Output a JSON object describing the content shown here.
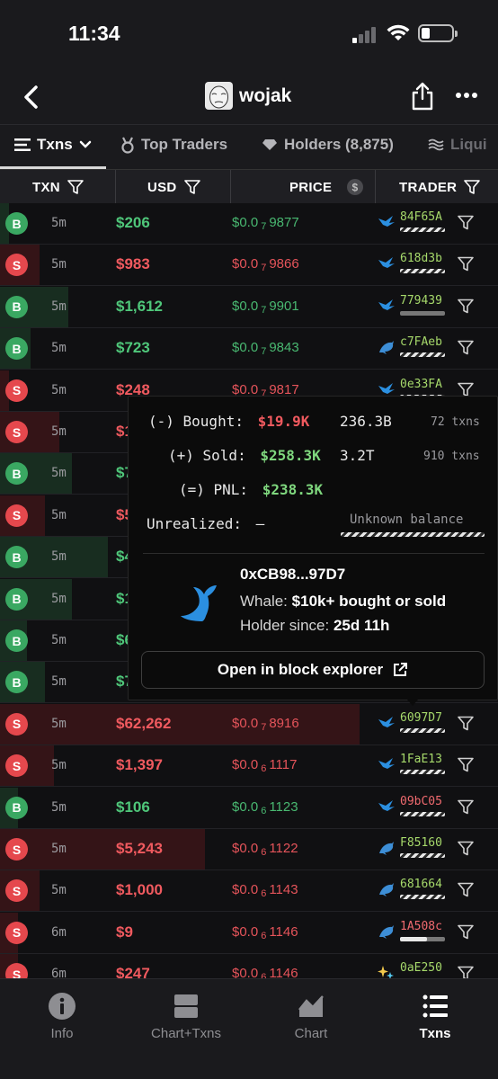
{
  "status": {
    "time": "11:34"
  },
  "header": {
    "token_name": "wojak"
  },
  "tabs": [
    {
      "label": "Txns",
      "active": true
    },
    {
      "label": "Top Traders"
    },
    {
      "label": "Holders (8,875)"
    },
    {
      "label": "Liqui"
    }
  ],
  "columns": {
    "txn": "TXN",
    "usd": "USD",
    "price": "PRICE",
    "trader": "TRADER"
  },
  "colors": {
    "buy": "#4fc77a",
    "sell": "#f05a5f",
    "bar": "#e8e8e8"
  },
  "rows": [
    {
      "type": "B",
      "age": "5m",
      "usd": "$206",
      "price_pre": "$0.0",
      "price_sub": "7",
      "price_post": "9877",
      "trader": "84F65A",
      "trader_icon": "bird-icon",
      "fill": 0.0,
      "hatched": true
    },
    {
      "type": "S",
      "age": "5m",
      "usd": "$983",
      "price_pre": "$0.0",
      "price_sub": "7",
      "price_post": "9866",
      "trader": "618d3b",
      "trader_icon": "bird-icon",
      "hatched": true
    },
    {
      "type": "B",
      "age": "5m",
      "usd": "$1,612",
      "price_pre": "$0.0",
      "price_sub": "7",
      "price_post": "9901",
      "trader": "779439",
      "trader_icon": "bird-icon",
      "hatched": false,
      "fill": 0.0
    },
    {
      "type": "B",
      "age": "5m",
      "usd": "$723",
      "price_pre": "$0.0",
      "price_sub": "7",
      "price_post": "9843",
      "trader": "c7FAeb",
      "trader_icon": "dolphin-icon",
      "hatched": true
    },
    {
      "type": "S",
      "age": "5m",
      "usd": "$248",
      "price_pre": "$0.0",
      "price_sub": "7",
      "price_post": "9817",
      "trader": "0e33FA",
      "trader_icon": "bird-icon",
      "hatched": true
    },
    {
      "type": "S",
      "age": "5m",
      "usd": "$1",
      "price_pre": "",
      "price_sub": "",
      "price_post": "",
      "trader": "",
      "trader_icon": ""
    },
    {
      "type": "B",
      "age": "5m",
      "usd": "$7",
      "price_pre": "",
      "price_sub": "",
      "price_post": "",
      "trader": "",
      "trader_icon": ""
    },
    {
      "type": "S",
      "age": "5m",
      "usd": "$5",
      "price_pre": "",
      "price_sub": "",
      "price_post": "",
      "trader": "",
      "trader_icon": ""
    },
    {
      "type": "B",
      "age": "5m",
      "usd": "$4",
      "price_pre": "",
      "price_sub": "",
      "price_post": "",
      "trader": "",
      "trader_icon": ""
    },
    {
      "type": "B",
      "age": "5m",
      "usd": "$1",
      "price_pre": "",
      "price_sub": "",
      "price_post": "",
      "trader": "",
      "trader_icon": ""
    },
    {
      "type": "B",
      "age": "5m",
      "usd": "$6",
      "price_pre": "",
      "price_sub": "",
      "price_post": "",
      "trader": "",
      "trader_icon": ""
    },
    {
      "type": "B",
      "age": "5m",
      "usd": "$7",
      "price_pre": "",
      "price_sub": "",
      "price_post": "",
      "trader": "",
      "trader_icon": ""
    },
    {
      "type": "S",
      "age": "5m",
      "usd": "$62,262",
      "price_pre": "$0.0",
      "price_sub": "7",
      "price_post": "8916",
      "trader": "6097D7",
      "trader_icon": "bird-icon",
      "hatched": true
    },
    {
      "type": "S",
      "age": "5m",
      "usd": "$1,397",
      "price_pre": "$0.0",
      "price_sub": "6",
      "price_post": "1117",
      "trader": "1FaE13",
      "trader_icon": "bird-icon",
      "hatched": true
    },
    {
      "type": "B",
      "age": "5m",
      "usd": "$106",
      "price_pre": "$0.0",
      "price_sub": "6",
      "price_post": "1123",
      "trader": "09bC05",
      "trader_icon": "bird-icon",
      "hatched": true
    },
    {
      "type": "S",
      "age": "5m",
      "usd": "$5,243",
      "price_pre": "$0.0",
      "price_sub": "6",
      "price_post": "1122",
      "trader": "F85160",
      "trader_icon": "dolphin-icon",
      "hatched": true
    },
    {
      "type": "S",
      "age": "5m",
      "usd": "$1,000",
      "price_pre": "$0.0",
      "price_sub": "6",
      "price_post": "1143",
      "trader": "681664",
      "trader_icon": "dolphin-icon",
      "hatched": true
    },
    {
      "type": "S",
      "age": "6m",
      "usd": "$9",
      "price_pre": "$0.0",
      "price_sub": "6",
      "price_post": "1146",
      "trader": "1A508c",
      "trader_icon": "dolphin-icon",
      "hatched": false,
      "fill": 0.6
    },
    {
      "type": "S",
      "age": "6m",
      "usd": "$247",
      "price_pre": "$0.0",
      "price_sub": "6",
      "price_post": "1146",
      "trader": "0aE250",
      "trader_icon": "sparkle-icon",
      "hatched": false
    }
  ],
  "popover": {
    "bought_label": "(-) Bought:",
    "bought_usd": "$19.9K",
    "bought_tokens": "236.3B",
    "bought_txns": "72 txns",
    "sold_label": "(+) Sold:",
    "sold_usd": "$258.3K",
    "sold_tokens": "3.2T",
    "sold_txns": "910 txns",
    "pnl_label": "(=) PNL:",
    "pnl_usd": "$238.3K",
    "unrealized_label": "Unrealized:",
    "unrealized_value": "–",
    "unknown_balance": "Unknown balance",
    "address": "0xCB98...97D7",
    "whale_prefix": "Whale:",
    "whale_desc": "$10k+ bought or sold",
    "holder_prefix": "Holder since:",
    "holder_since": "25d 11h",
    "explorer_button": "Open in block explorer"
  },
  "bottom_tabs": [
    {
      "label": "Info",
      "icon": "info-icon"
    },
    {
      "label": "Chart+Txns",
      "icon": "split-view-icon"
    },
    {
      "label": "Chart",
      "icon": "chart-icon"
    },
    {
      "label": "Txns",
      "icon": "list-icon",
      "active": true
    }
  ]
}
